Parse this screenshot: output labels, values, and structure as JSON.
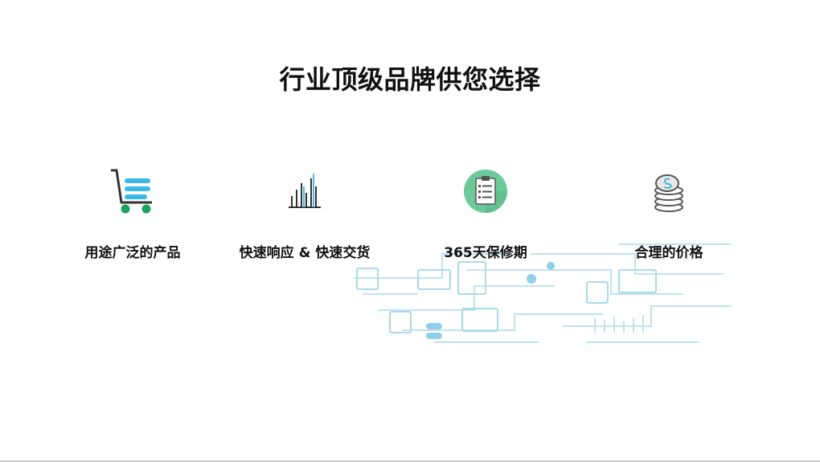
{
  "title": "行业顶级品牌供您选择",
  "features": [
    {
      "label": "用途广泛的产品",
      "icon": "shopping-cart-icon"
    },
    {
      "label": "快速响应 & 快速交货",
      "icon": "bar-chart-icon"
    },
    {
      "label": "365天保修期",
      "icon": "clipboard-icon"
    },
    {
      "label": "合理的价格",
      "icon": "coin-stack-icon"
    }
  ],
  "colors": {
    "title": "#111111",
    "cart_bars": "#3ab8e8",
    "cart_wheels": "#1aa35c",
    "chart_accent": "#4fb7e0",
    "clipboard_bg": "#6cc99a",
    "circuit": "#bfe2ef"
  }
}
